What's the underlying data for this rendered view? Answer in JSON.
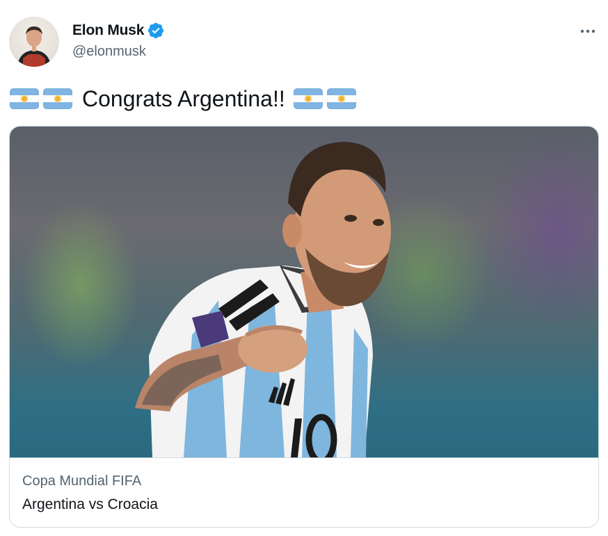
{
  "author": {
    "name": "Elon Musk",
    "handle": "@elonmusk",
    "verified": true,
    "avatar_icon": "profile-photo"
  },
  "more_icon": "ellipsis-icon",
  "tweet": {
    "text": "Congrats Argentina!!",
    "leading_emoji": [
      "argentina-flag",
      "argentina-flag"
    ],
    "trailing_emoji": [
      "argentina-flag",
      "argentina-flag"
    ]
  },
  "card": {
    "image_subject": "football-player-celebrating",
    "domain": "Copa Mundial FIFA",
    "title": "Argentina vs Croacia"
  },
  "colors": {
    "text": "#0f1419",
    "secondary": "#536471",
    "verified_blue": "#1d9bf0",
    "border": "#cfd9de",
    "flag_blue": "#7fb4e3",
    "flag_sun": "#f2b233"
  }
}
